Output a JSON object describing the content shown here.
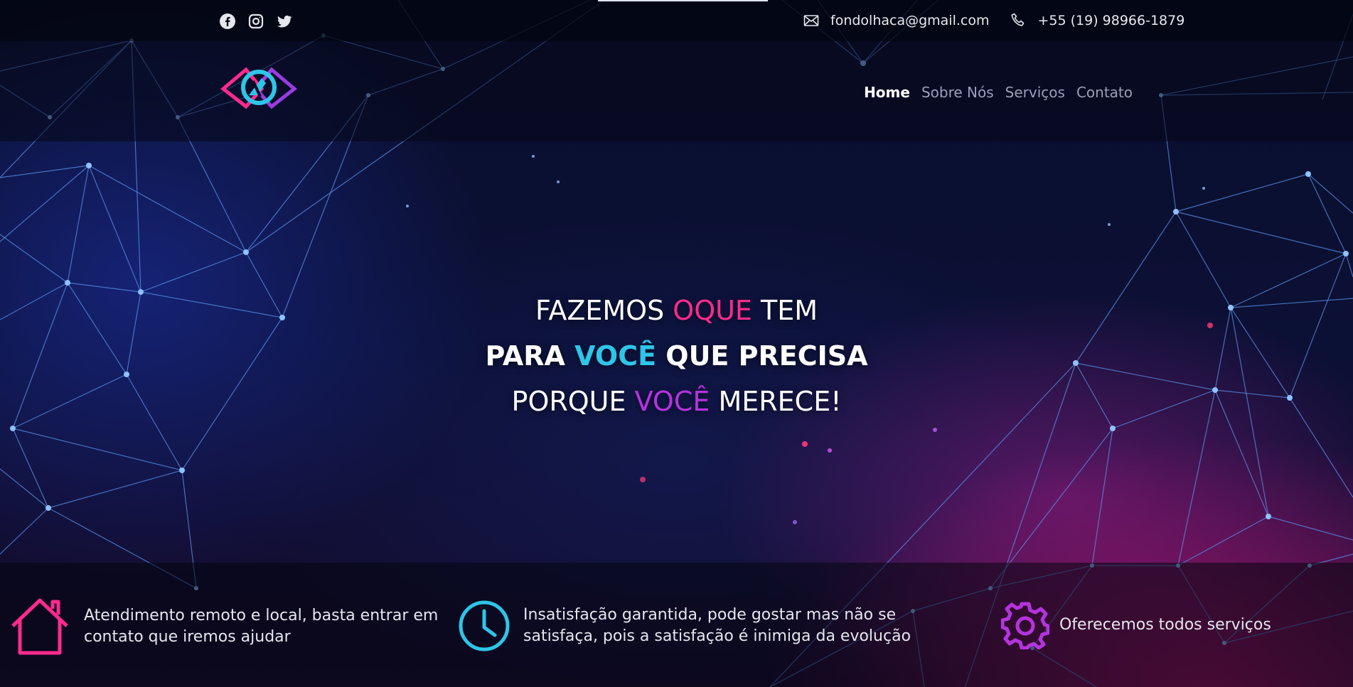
{
  "topbar": {
    "social_icons": [
      "facebook-icon",
      "instagram-icon",
      "twitter-icon"
    ],
    "email": "fondolhaca@gmail.com",
    "phone": "+55 (19) 98966-1879"
  },
  "nav": {
    "items": [
      {
        "label": "Home",
        "active": true
      },
      {
        "label": "Sobre Nós",
        "active": false
      },
      {
        "label": "Serviços",
        "active": false
      },
      {
        "label": "Contato",
        "active": false
      }
    ]
  },
  "hero": {
    "line1": {
      "a": "FAZEMOS ",
      "b": "OQUE",
      "c": " TEM"
    },
    "line2": {
      "a": "PARA ",
      "b": "VOCÊ",
      "c": " QUE PRECISA"
    },
    "line3": {
      "a": "PORQUE ",
      "b": "VOCÊ",
      "c": " MERECE!"
    }
  },
  "features": [
    {
      "icon": "home-icon",
      "text_line1": "Atendimento remoto e local, basta entrar em",
      "text_line2": "contato que iremos ajudar"
    },
    {
      "icon": "clock-icon",
      "text_line1": "Insatisfação garantida, pode gostar mas não se",
      "text_line2": "satisfaça, pois a satisfação é inimiga da evolução"
    },
    {
      "icon": "gear-icon",
      "text_line1": "Oferecemos todos serviços",
      "text_line2": ""
    }
  ],
  "colors": {
    "pink": "#ff2a8e",
    "cyan": "#2ec5e8",
    "purple": "#b633e0",
    "background": "#070b24"
  }
}
